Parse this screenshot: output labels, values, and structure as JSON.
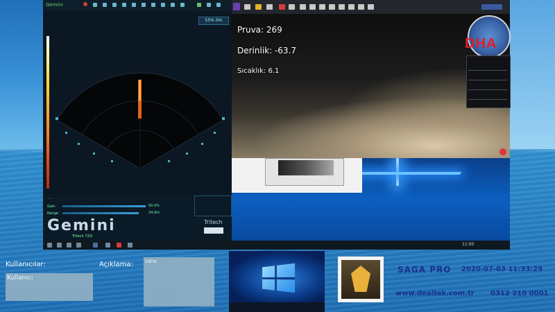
{
  "gemini": {
    "brand": "Gemini",
    "range_label": "55% 0m",
    "logo_text": "Gemini",
    "sub_text": "Tritech 720i",
    "tritech": "Tritech",
    "bottom_labels": [
      "Gain",
      "Range",
      "Ping"
    ],
    "bottom_values": [
      "50.0%",
      "24.0m"
    ]
  },
  "camera": {
    "pruva": "Pruva: 269",
    "derinlik": "Derinlik: -63.7",
    "sicaklik": "Sıcaklık: 6.1"
  },
  "watermark": "DHA",
  "taskbar": {
    "clock": "11:00"
  },
  "bottom": {
    "user_label": "Kullanıcılar:",
    "user_value": "Kullanıcı",
    "desc_label": "Açıklama:",
    "desc_value": "saha",
    "saga_title": "SAGA PRO",
    "saga_date": "2020-07-03 11:33:29",
    "saga_web": "www.dealtek.com.tr",
    "saga_phone": "0312 210 0001"
  }
}
